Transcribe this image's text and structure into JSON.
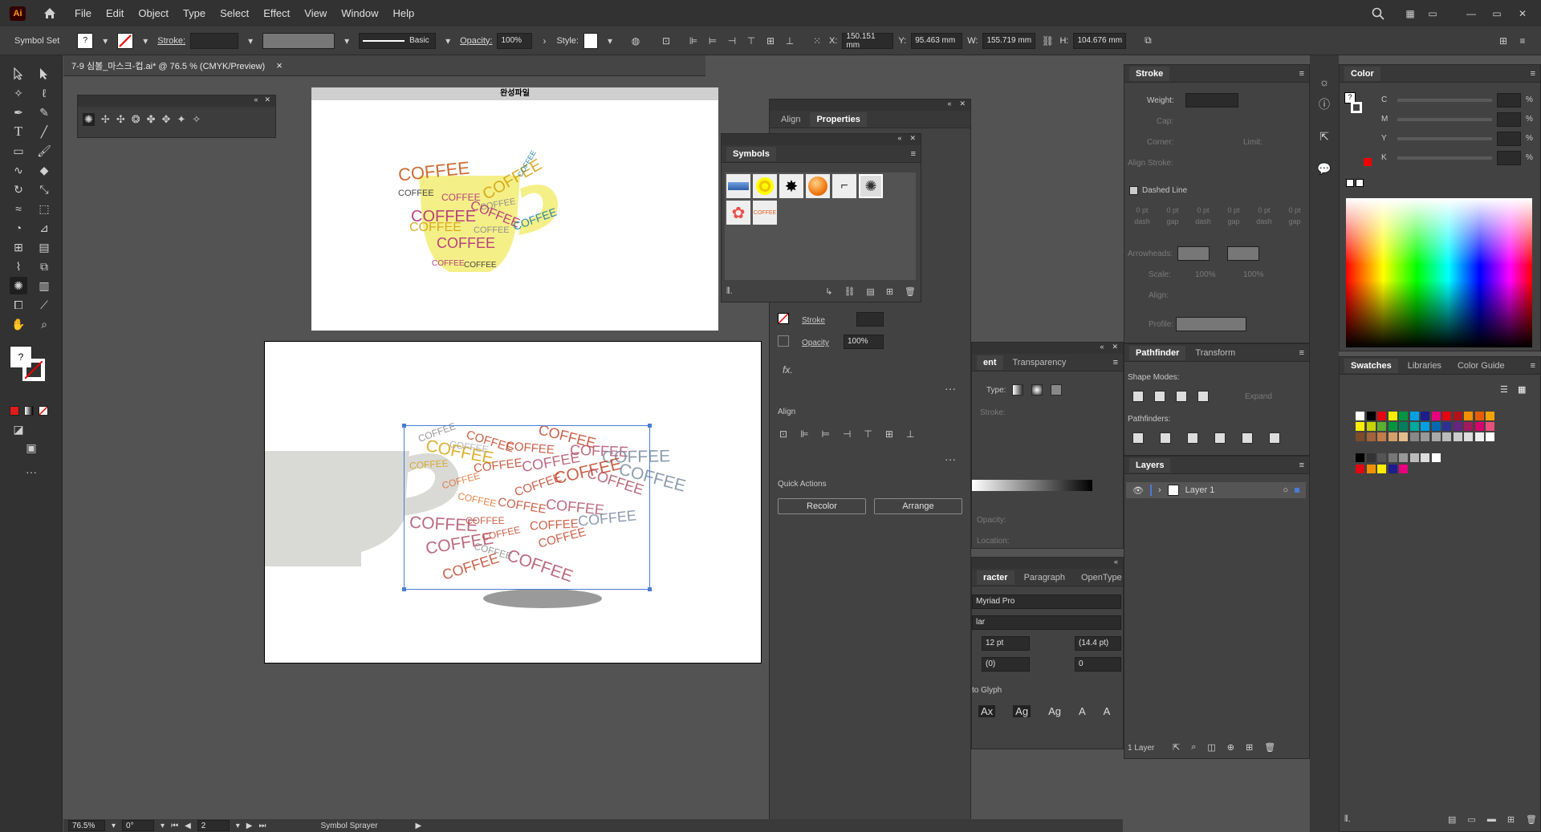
{
  "app": {
    "logo": "Ai",
    "menus": [
      "File",
      "Edit",
      "Object",
      "Type",
      "Select",
      "Effect",
      "View",
      "Window",
      "Help"
    ]
  },
  "control": {
    "tool_name": "Symbol Set",
    "stroke_label": "Stroke:",
    "brush_label": "Basic",
    "opacity_label": "Opacity:",
    "opacity_value": "100%",
    "style_label": "Style:",
    "x_label": "X:",
    "x_value": "150.151 mm",
    "y_label": "Y:",
    "y_value": "95.463 mm",
    "w_label": "W:",
    "w_value": "155.719 mm",
    "h_label": "H:",
    "h_value": "104.676 mm"
  },
  "document": {
    "tab_title": "7-9 심볼_마스크-컵.ai* @ 76.5 % (CMYK/Preview)",
    "close": "×"
  },
  "artboard1": {
    "title": "완성파일"
  },
  "cup_word": "COFFEE",
  "status": {
    "zoom": "76.5%",
    "rotation": "0°",
    "artboard": "2",
    "tool": "Symbol Sprayer"
  },
  "properties_panel": {
    "tabs": [
      "Align",
      "Properties"
    ],
    "stroke_label": "Stroke",
    "opacity_label": "Opacity",
    "opacity_value": "100%",
    "fx_label": "fx.",
    "align_title": "Align",
    "quick_actions_title": "Quick Actions",
    "recolor_btn": "Recolor",
    "arrange_btn": "Arrange"
  },
  "symbols_panel": {
    "title": "Symbols",
    "coffee_symbol": "COFFEE"
  },
  "transparency_panel": {
    "tabs": [
      "ent",
      "Transparency"
    ],
    "type_label": "Type:",
    "stroke_label": "Stroke:",
    "opacity_label": "Opacity:",
    "location_label": "Location:"
  },
  "character_panel": {
    "tabs": [
      "racter",
      "Paragraph",
      "OpenType"
    ],
    "font": "Myriad Pro",
    "style": "lar",
    "size": "12 pt",
    "leading": "(14.4 pt)",
    "kerning": "(0)",
    "tracking": "0",
    "glyph": "to Glyph"
  },
  "stroke_panel": {
    "title": "Stroke",
    "weight": "Weight:",
    "cap": "Cap:",
    "corner": "Corner:",
    "limit": "Limit:",
    "align_stroke": "Align Stroke:",
    "dashed": "Dashed Line",
    "dash_labels": [
      "dash",
      "gap",
      "dash",
      "gap",
      "dash",
      "gap"
    ],
    "dash_vals": [
      "0 pt",
      "0 pt",
      "0 pt",
      "0 pt",
      "0 pt",
      "0 pt"
    ],
    "arrowheads": "Arrowheads:",
    "scale": "Scale:",
    "scale1": "100%",
    "scale2": "100%",
    "align": "Align:",
    "profile": "Profile:"
  },
  "pathfinder_panel": {
    "tabs": [
      "Pathfinder",
      "Transform"
    ],
    "shape_modes": "Shape Modes:",
    "pathfinders": "Pathfinders:",
    "expand": "Expand"
  },
  "layers_panel": {
    "title": "Layers",
    "layer_name": "Layer 1",
    "footer": "1 Layer"
  },
  "color_panel": {
    "title": "Color",
    "channels": [
      "C",
      "M",
      "Y",
      "K"
    ],
    "unit": "%"
  },
  "swatches_panel": {
    "tabs": [
      "Swatches",
      "Libraries",
      "Color Guide"
    ]
  }
}
